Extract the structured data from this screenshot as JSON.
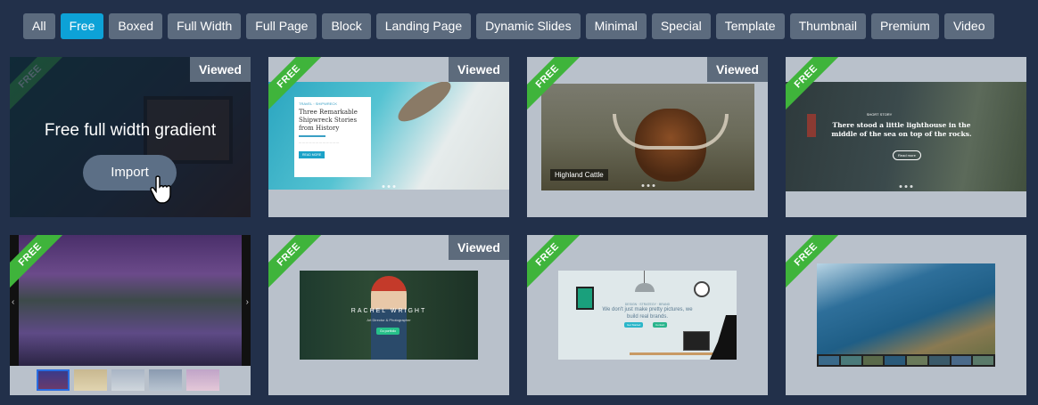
{
  "filters": [
    "All",
    "Free",
    "Boxed",
    "Full Width",
    "Full Page",
    "Block",
    "Landing Page",
    "Dynamic Slides",
    "Minimal",
    "Special",
    "Template",
    "Thumbnail",
    "Premium",
    "Video"
  ],
  "active_filter": "Free",
  "ribbon_label": "FREE",
  "viewed_label": "Viewed",
  "cards": {
    "c1": {
      "hover_title": "Free full width gradient",
      "import_label": "Import"
    },
    "c2": {
      "kicker": "TRAVEL ◦ SHIPWRECK",
      "headline": "Three Remarkable Shipwreck Stories from History",
      "button": "READ MORE"
    },
    "c3": {
      "caption": "Highland Cattle"
    },
    "c4": {
      "kicker": "SHORT STORY",
      "headline": "There stood a little lighthouse in the middle of the sea on top of the rocks.",
      "button": "Read more"
    },
    "c6": {
      "name": "RACHEL WRIGHT",
      "role": "Art Director & Photographer",
      "button": "Go portfolio"
    },
    "c7": {
      "kicker": "DESIGN · STRATEGY · BRAND",
      "headline": "We don't just make pretty pictures, we build real brands.",
      "btn1": "Get Started",
      "btn2": "Contact"
    }
  }
}
